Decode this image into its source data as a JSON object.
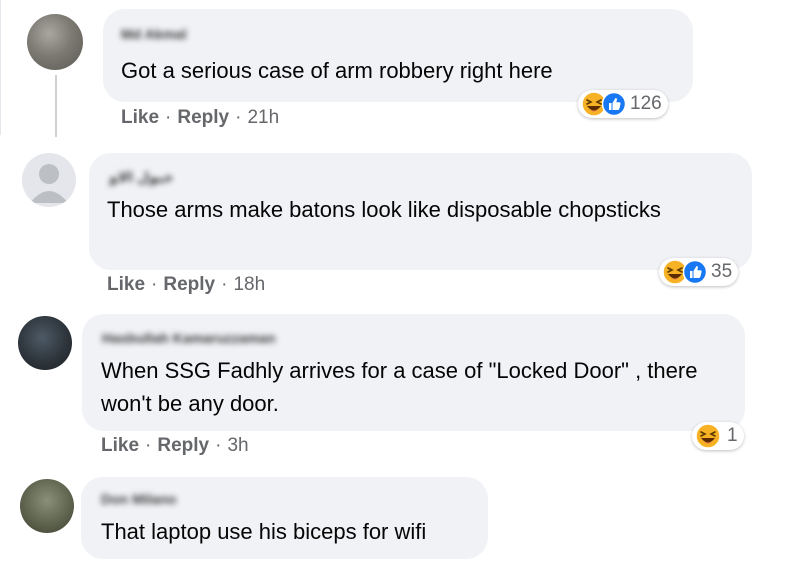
{
  "colors": {
    "bubble": "#f0f2f5",
    "meta_text": "#65676b",
    "haha_emoji": "#f7b125",
    "like_blue": "#1877f2"
  },
  "comments": [
    {
      "author": "Md Akmal",
      "text": "Got a serious case of arm robbery right here",
      "like_label": "Like",
      "reply_label": "Reply",
      "time": "21h",
      "reactions": [
        "haha-icon",
        "like-icon"
      ],
      "reaction_count": "126"
    },
    {
      "author": "خيول الاو",
      "text": "Those arms make batons look like disposable chopsticks",
      "like_label": "Like",
      "reply_label": "Reply",
      "time": "18h",
      "reactions": [
        "haha-icon",
        "like-icon"
      ],
      "reaction_count": "35"
    },
    {
      "author": "Hasbullah Kamaruzzaman",
      "text": "When SSG Fadhly arrives for a case of \"Locked Door\" , there won't be any door.",
      "like_label": "Like",
      "reply_label": "Reply",
      "time": "3h",
      "reactions": [
        "haha-icon"
      ],
      "reaction_count": "1"
    },
    {
      "author": "Don Milano",
      "text": "That laptop use his biceps for wifi"
    }
  ]
}
